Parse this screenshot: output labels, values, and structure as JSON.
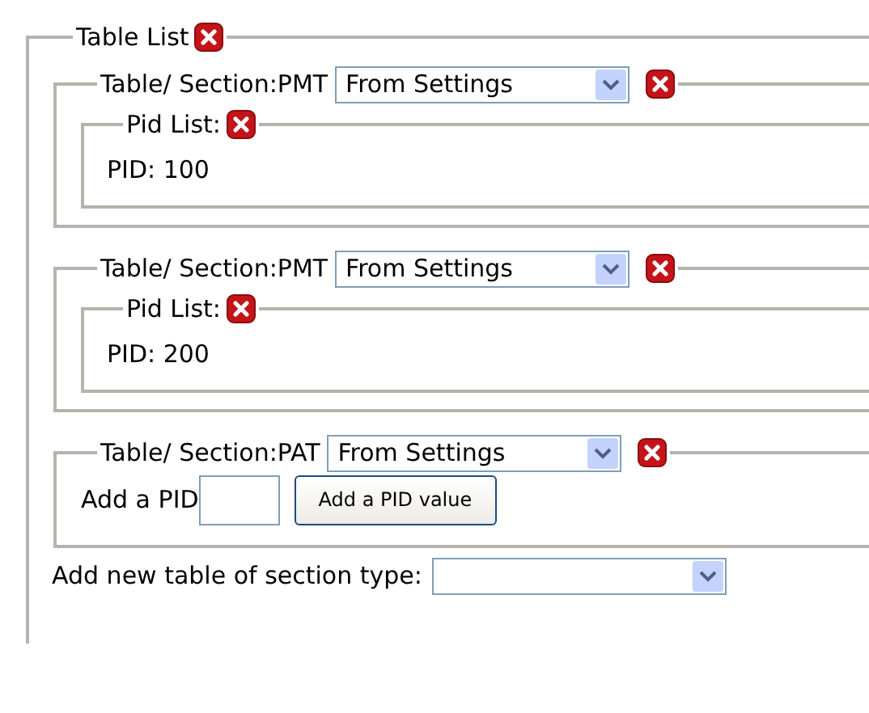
{
  "table_list": {
    "title": "Table List",
    "tables": [
      {
        "kind": "pid_list",
        "label": "Table/ Section:PMT",
        "source": "From Settings",
        "pid_list": {
          "title": "Pid List:",
          "pids": [
            "PID: 100"
          ]
        }
      },
      {
        "kind": "pid_list",
        "label": "Table/ Section:PMT",
        "source": "From Settings",
        "pid_list": {
          "title": "Pid List:",
          "pids": [
            "PID: 200"
          ]
        }
      },
      {
        "kind": "add_pid",
        "label": "Table/ Section:PAT",
        "source": "From Settings",
        "add_label": "Add a PID",
        "add_button": "Add a PID value"
      }
    ],
    "add_table": {
      "label": "Add new table of section type:"
    }
  }
}
